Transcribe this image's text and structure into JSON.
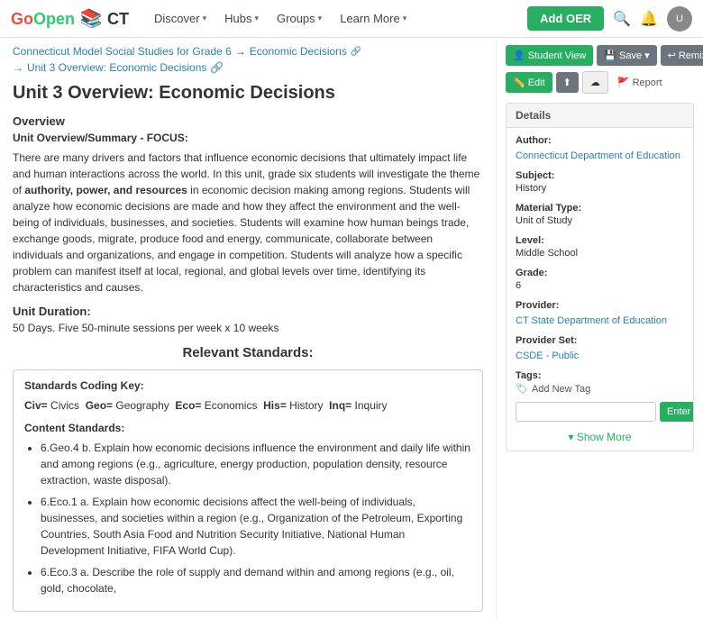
{
  "header": {
    "logo": {
      "go": "Go",
      "open": "Open",
      "books_icon": "📚",
      "ct": "CT"
    },
    "nav": [
      {
        "label": "Discover",
        "id": "discover"
      },
      {
        "label": "Hubs",
        "id": "hubs"
      },
      {
        "label": "Groups",
        "id": "groups"
      },
      {
        "label": "Learn More",
        "id": "learn-more"
      }
    ],
    "add_oer_label": "Add OER"
  },
  "breadcrumb": {
    "parent": "Connecticut Model Social Studies for Grade 6",
    "arrow": "→",
    "current": "Economic Decisions",
    "sub_arrow": "→",
    "sub": "Unit 3 Overview: Economic Decisions"
  },
  "page": {
    "title": "Unit 3 Overview: Economic Decisions",
    "overview_label": "Overview",
    "summary_label": "Unit Overview/Summary - FOCUS:",
    "summary_text_1": "There are many drivers and factors that influence economic decisions that ultimately impact life and human interactions across the world. In this unit, grade six students will investigate the theme of ",
    "summary_bold": "authority, power, and resources",
    "summary_text_2": " in economic decision making among regions. Students will analyze how economic decisions are made and how they affect the environment and the well-being of individuals, businesses, and societies. Students will examine how human beings trade, exchange goods, migrate, produce food and energy, communicate, collaborate between individuals and organizations, and engage in competition. Students will analyze how a specific problem can manifest itself at local, regional, and global levels over time, identifying its characteristics and causes.",
    "duration_label": "Unit Duration:",
    "duration_text": "50 Days. Five 50-minute sessions per week x 10 weeks",
    "standards_title": "Relevant Standards:",
    "coding_key_label": "Standards Coding Key:",
    "coding_key": [
      {
        "abbr": "Civ=",
        "full": "Civics"
      },
      {
        "abbr": "Geo=",
        "full": "Geography"
      },
      {
        "abbr": "Eco=",
        "full": "Economics"
      },
      {
        "abbr": "His=",
        "full": "History"
      },
      {
        "abbr": "Inq=",
        "full": "Inquiry"
      }
    ],
    "content_standards_label": "Content Standards:",
    "standards": [
      "6.Geo.4  b. Explain how economic decisions influence the environment and daily life within and among regions (e.g., agriculture, energy production, population density, resource extraction, waste disposal).",
      "6.Eco.1  a. Explain how economic decisions affect the well-being of individuals, businesses, and societies within a region (e.g., Organization of the Petroleum, Exporting Countries, South Asia Food and Nutrition Security Initiative, National Human Development Initiative, FIFA World Cup).",
      "6.Eco.3  a. Describe the role of supply and demand within and among regions (e.g., oil, gold, chocolate,"
    ]
  },
  "sidebar": {
    "buttons_top": [
      {
        "label": "Student View",
        "icon": "👤",
        "type": "green"
      },
      {
        "label": "Save",
        "icon": "💾",
        "type": "gray"
      },
      {
        "label": "Remix",
        "icon": "↩",
        "type": "gray"
      }
    ],
    "buttons_bottom": [
      {
        "label": "Edit",
        "icon": "✏️",
        "type": "green"
      },
      {
        "label": "",
        "icon": "⬆",
        "type": "gray"
      },
      {
        "label": "",
        "icon": "☁",
        "type": "light"
      },
      {
        "label": "Report",
        "icon": "🚩",
        "type": "report"
      }
    ],
    "details_header": "Details",
    "author_label": "Author:",
    "author_value": "Connecticut Department of Education",
    "subject_label": "Subject:",
    "subject_value": "History",
    "material_type_label": "Material Type:",
    "material_type_value": "Unit of Study",
    "level_label": "Level:",
    "level_value": "Middle School",
    "grade_label": "Grade:",
    "grade_value": "6",
    "provider_label": "Provider:",
    "provider_value": "CT State Department of Education",
    "provider_set_label": "Provider Set:",
    "provider_set_value": "CSDE - Public",
    "tags_label": "Tags:",
    "add_tag_label": "Add New Tag",
    "tag_input_placeholder": "",
    "enter_btn_label": "Enter",
    "show_more_label": "Show More"
  }
}
